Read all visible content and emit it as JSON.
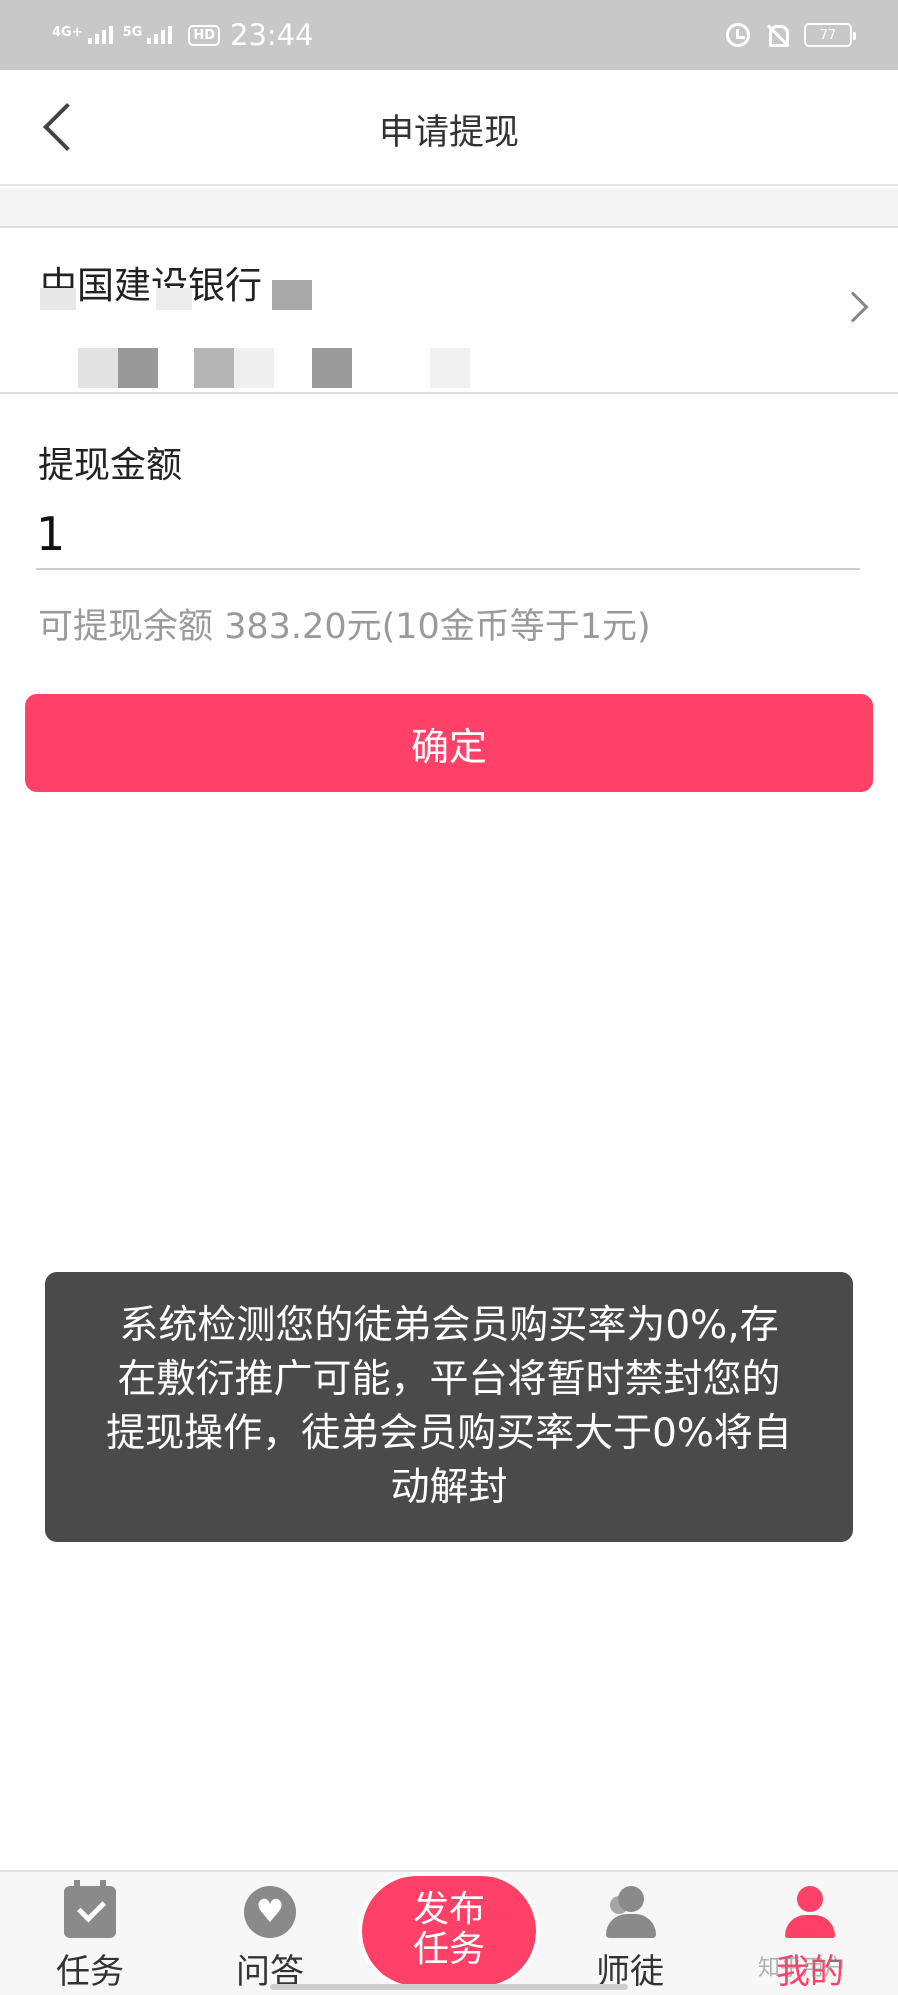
{
  "status_bar": {
    "network1": "4G+",
    "network2": "5G",
    "hd": "HD",
    "time": "23:44",
    "battery": "77"
  },
  "nav": {
    "title": "申请提现"
  },
  "bank": {
    "name": "中国建设银行"
  },
  "withdraw": {
    "amount_label": "提现金额",
    "amount_value": "1",
    "balance_text": "可提现余额 383.20元(10金币等于1元)",
    "confirm_label": "确定"
  },
  "toast": {
    "message": "系统检测您的徒弟会员购买率为0%,存在敷衍推广可能，平台将暂时禁封您的提现操作，徒弟会员购买率大于0%将自动解封"
  },
  "tabbar": {
    "tabs": [
      {
        "label": "任务",
        "icon": "task-calendar-icon"
      },
      {
        "label": "问答",
        "icon": "heart-bubble-icon"
      },
      {
        "label": "师徒",
        "icon": "mentor-users-icon"
      },
      {
        "label": "我的",
        "icon": "user-icon"
      }
    ],
    "publish_line1": "发布",
    "publish_line2": "任务",
    "active_color": "#ff4168"
  },
  "watermark": "知乎用户"
}
